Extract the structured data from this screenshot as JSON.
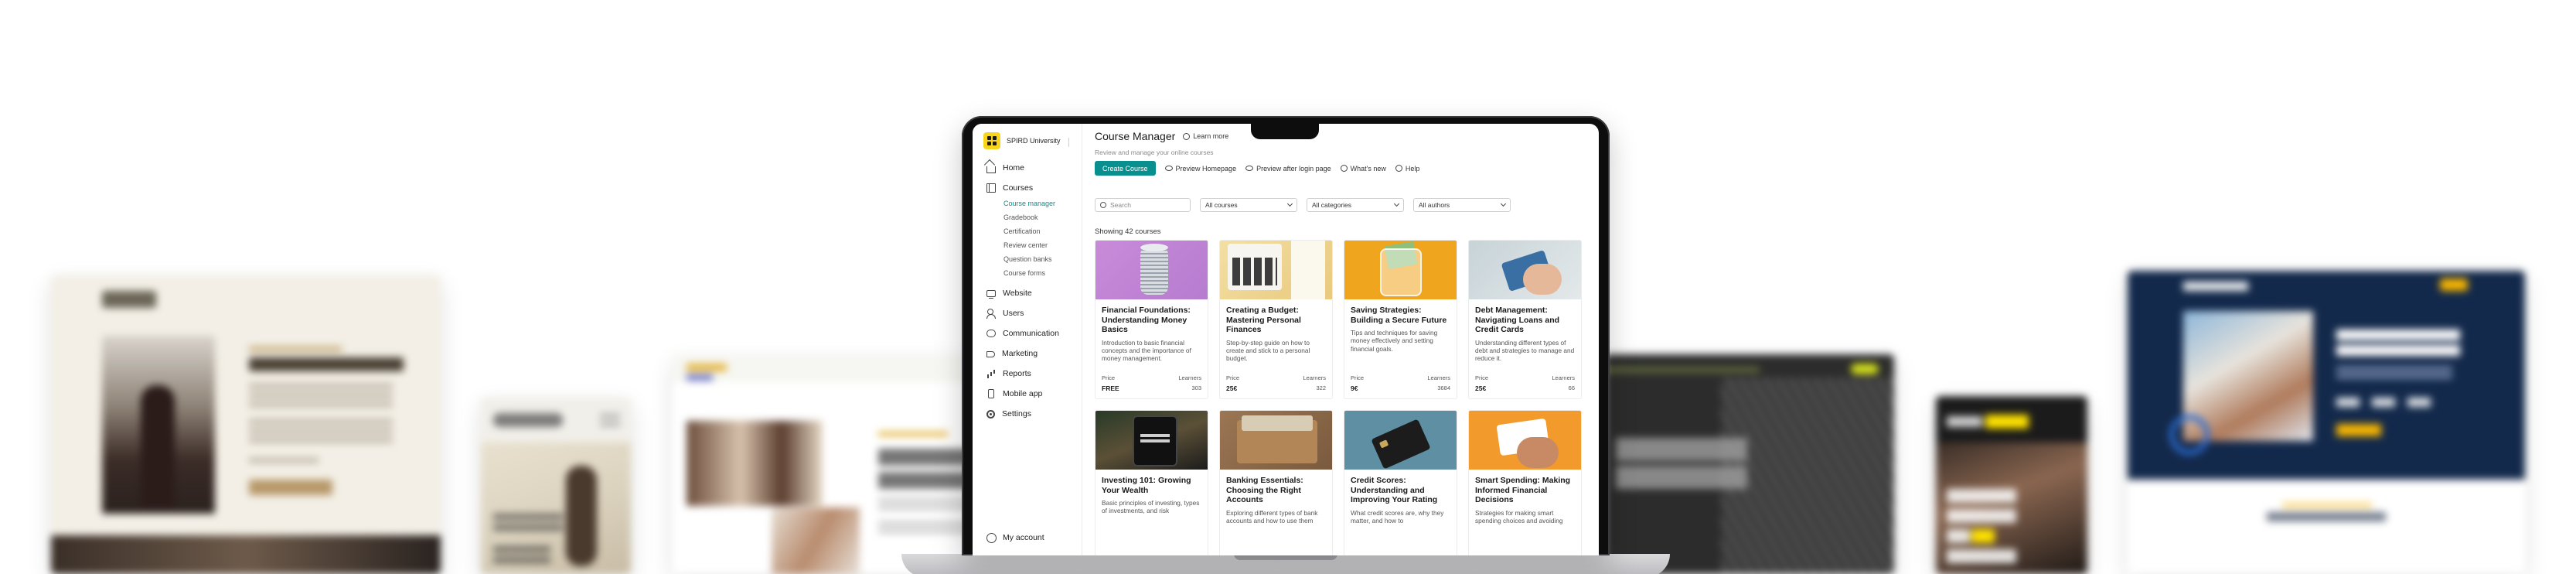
{
  "app": {
    "org_name": "SPIRD University",
    "page_title": "Course Manager",
    "learn_more": "Learn more",
    "subtitle": "Review and manage your online courses",
    "accent_color": "#0a8f8f",
    "brand_color": "#f7d51d"
  },
  "actions": {
    "create_course": "Create Course",
    "preview_homepage": "Preview Homepage",
    "preview_after_login": "Preview after login page",
    "whats_new": "What's new",
    "help": "Help"
  },
  "sidebar": {
    "items": [
      {
        "label": "Home",
        "icon": "home-icon"
      },
      {
        "label": "Courses",
        "icon": "book-icon"
      },
      {
        "label": "Website",
        "icon": "monitor-icon"
      },
      {
        "label": "Users",
        "icon": "users-icon"
      },
      {
        "label": "Communication",
        "icon": "chat-icon"
      },
      {
        "label": "Marketing",
        "icon": "megaphone-icon"
      },
      {
        "label": "Reports",
        "icon": "chart-icon"
      },
      {
        "label": "Mobile app",
        "icon": "phone-icon"
      },
      {
        "label": "Settings",
        "icon": "gear-icon"
      }
    ],
    "courses_sub": [
      {
        "label": "Course manager",
        "active": true
      },
      {
        "label": "Gradebook"
      },
      {
        "label": "Certification"
      },
      {
        "label": "Review center"
      },
      {
        "label": "Question banks"
      },
      {
        "label": "Course forms"
      }
    ],
    "account": "My account"
  },
  "filters": {
    "search_placeholder": "Search",
    "courses": "All courses",
    "categories": "All categories",
    "authors": "All authors"
  },
  "showing": "Showing 42 courses",
  "labels": {
    "price": "Price",
    "learners": "Learners"
  },
  "courses": [
    {
      "title": "Financial Foundations: Understanding Money Basics",
      "desc": "Introduction to basic financial concepts and the importance of money management.",
      "price": "FREE",
      "learners": "303"
    },
    {
      "title": "Creating a Budget: Mastering Personal Finances",
      "desc": "Step-by-step guide on how to create and stick to a personal budget.",
      "price": "25€",
      "learners": "322"
    },
    {
      "title": "Saving Strategies: Building a Secure Future",
      "desc": "Tips and techniques for saving money effectively and setting financial goals.",
      "price": "9€",
      "learners": "3684"
    },
    {
      "title": "Debt Management: Navigating Loans and Credit Cards",
      "desc": "Understanding different types of debt and strategies to manage and reduce it.",
      "price": "25€",
      "learners": "66"
    },
    {
      "title": "Investing 101: Growing Your Wealth",
      "desc": "Basic principles of investing, types of investments, and risk",
      "price": "",
      "learners": ""
    },
    {
      "title": "Banking Essentials: Choosing the Right Accounts",
      "desc": "Exploring different types of bank accounts and how to use them",
      "price": "",
      "learners": ""
    },
    {
      "title": "Credit Scores: Understanding and Improving Your Rating",
      "desc": "What credit scores are, why they matter, and how to",
      "price": "",
      "learners": ""
    },
    {
      "title": "Smart Spending: Making Informed Financial Decisions",
      "desc": "Strategies for making smart spending choices and avoiding",
      "price": "",
      "learners": ""
    }
  ]
}
